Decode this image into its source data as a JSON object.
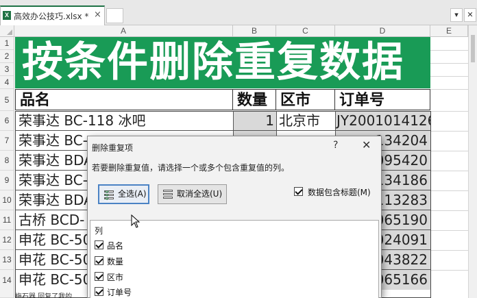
{
  "workbook": {
    "tab_title": "高效办公技巧.xlsx *",
    "tab_close": "×",
    "file_icon": "X"
  },
  "toolbar": {
    "dropdown_glyph": "▾",
    "close_glyph": "✕"
  },
  "columns": [
    "A",
    "B",
    "C",
    "D",
    "E"
  ],
  "rows": [
    "1",
    "2",
    "3",
    "4",
    "5",
    "6",
    "7",
    "8",
    "9",
    "10",
    "11",
    "12",
    "13",
    "14"
  ],
  "sheet": {
    "title": "按条件删除重复数据",
    "title_bg": "#199b56",
    "headers": {
      "name": "品名",
      "qty": "数量",
      "city": "区市",
      "order": "订单号"
    },
    "data_rows": [
      {
        "name": "荣事达 BC-118 冰吧",
        "qty": "1",
        "city": "北京市",
        "order": "JY2001014126"
      },
      {
        "name": "荣事达 BC-",
        "qty": "",
        "city": "",
        "order": "134204"
      },
      {
        "name": "荣事达 BDA",
        "qty": "",
        "city": "",
        "order": "095420"
      },
      {
        "name": "荣事达 BC-",
        "qty": "",
        "city": "",
        "order": "134186"
      },
      {
        "name": "荣事达 BDA",
        "qty": "",
        "city": "",
        "order": "113283"
      },
      {
        "name": "古桥 BCD-",
        "qty": "",
        "city": "",
        "order": "065190"
      },
      {
        "name": "申花 BC-50",
        "qty": "",
        "city": "",
        "order": "024091"
      },
      {
        "name": "申花 BC-50",
        "qty": "",
        "city": "",
        "order": "043822"
      },
      {
        "name": "申花 BC-50",
        "qty": "",
        "city": "",
        "order": "065166"
      }
    ],
    "footer_fragment": "梅石器 回复了我的"
  },
  "dialog": {
    "title": "删除重复项",
    "help": "?",
    "close": "✕",
    "description": "若要删除重复值，请选择一个或多个包含重复值的列。",
    "select_all": "全选(A)",
    "unselect_all": "取消全选(U)",
    "has_headers_label": "数据包含标题(M)",
    "has_headers_checked": true,
    "list_title": "列",
    "list_items": [
      {
        "label": "品名",
        "checked": true
      },
      {
        "label": "数量",
        "checked": true
      },
      {
        "label": "区市",
        "checked": true
      },
      {
        "label": "订单号",
        "checked": true
      }
    ]
  }
}
